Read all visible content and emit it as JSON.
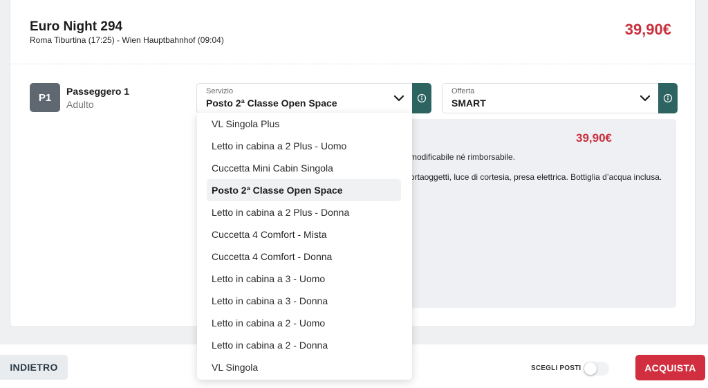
{
  "train": {
    "name": "Euro Night 294",
    "route": "Roma Tiburtina (17:25) - Wien Hauptbahnhof (09:04)",
    "price": "39,90€"
  },
  "passenger": {
    "badge": "P1",
    "name": "Passeggero 1",
    "type": "Adulto"
  },
  "service": {
    "label": "Servizio",
    "value": "Posto 2ª Classe Open Space"
  },
  "offer": {
    "label": "Offerta",
    "value": "SMART",
    "price": "39,90€",
    "note": "modificabile né rimborsabile.",
    "description": "ortaoggetti, luce di cortesia, presa elettrica. Bottiglia d’acqua inclusa."
  },
  "dropdown": {
    "options": [
      "VL Singola Plus",
      "Letto in cabina a 2 Plus - Uomo",
      "Cuccetta Mini Cabin Singola",
      "Posto 2ª Classe Open Space",
      "Letto in cabina a 2 Plus - Donna",
      "Cuccetta 4 Comfort - Mista",
      "Cuccetta 4 Comfort - Donna",
      "Letto in cabina a 3 - Uomo",
      "Letto in cabina a 3 - Donna",
      "Letto in cabina a 2 - Uomo",
      "Letto in cabina a 2 - Donna",
      "VL Singola"
    ],
    "selected_index": 3
  },
  "footer": {
    "back_label": "INDIETRO",
    "seat_label": "SCEGLI POSTI",
    "buy_label": "ACQUISTA"
  },
  "colors": {
    "price_red": "#c9303c",
    "teal": "#2d6461",
    "buy_red": "#d12f3f",
    "badge_gray": "#5f6870"
  },
  "icons": [
    "chevron-down-icon",
    "info-icon"
  ]
}
